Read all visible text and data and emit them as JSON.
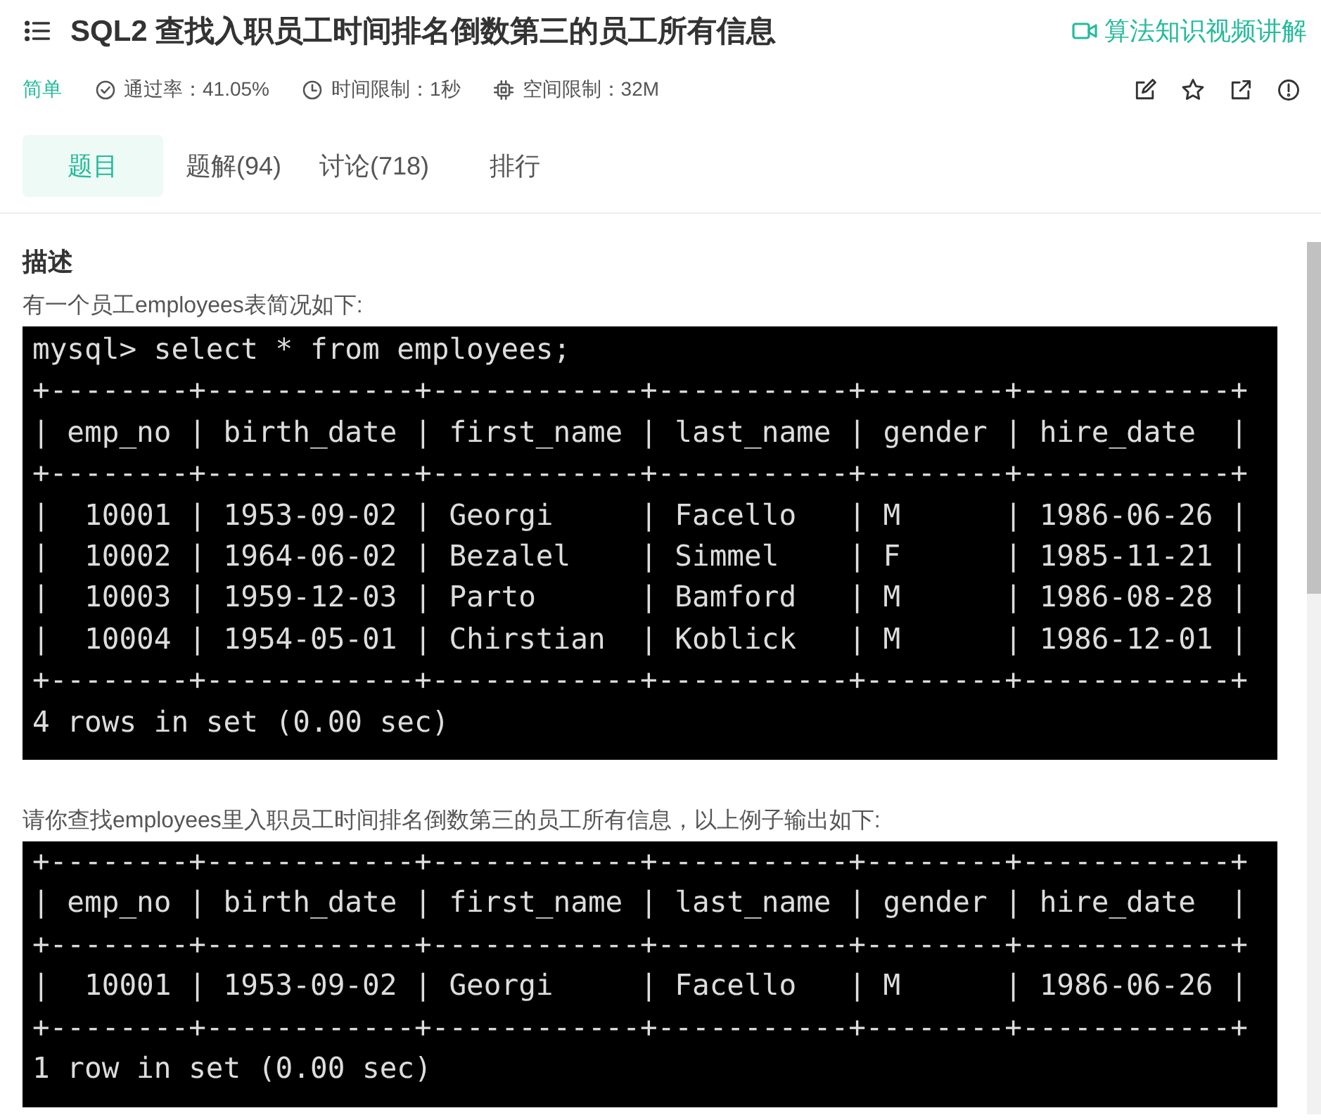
{
  "header": {
    "title": "SQL2  查找入职员工时间排名倒数第三的员工所有信息",
    "video_link": "算法知识视频讲解"
  },
  "meta": {
    "difficulty": "简单",
    "items": [
      {
        "kind": "pass",
        "text": "通过率：41.05%"
      },
      {
        "kind": "time",
        "text": "时间限制：1秒"
      },
      {
        "kind": "memory",
        "text": "空间限制：32M"
      }
    ]
  },
  "tabs": [
    {
      "label": "题目",
      "selected": true
    },
    {
      "label": "题解(94)",
      "selected": false
    },
    {
      "label": "讨论(718)",
      "selected": false
    },
    {
      "label": "排行",
      "selected": false
    }
  ],
  "content": {
    "heading": "描述",
    "blocks": [
      {
        "kind": "text",
        "text": "有一个员工employees表简况如下:"
      },
      {
        "kind": "terminal",
        "lines": [
          "mysql> select * from employees;",
          "+--------+------------+------------+-----------+--------+------------+",
          "| emp_no | birth_date | first_name | last_name | gender | hire_date  |",
          "+--------+------------+------------+-----------+--------+------------+",
          "|  10001 | 1953-09-02 | Georgi     | Facello   | M      | 1986-06-26 |",
          "|  10002 | 1964-06-02 | Bezalel    | Simmel    | F      | 1985-11-21 |",
          "|  10003 | 1959-12-03 | Parto      | Bamford   | M      | 1986-08-28 |",
          "|  10004 | 1954-05-01 | Chirstian  | Koblick   | M      | 1986-12-01 |",
          "+--------+------------+------------+-----------+--------+------------+",
          "4 rows in set (0.00 sec)"
        ]
      },
      {
        "kind": "text",
        "text": "请你查找employees里入职员工时间排名倒数第三的员工所有信息，以上例子输出如下:"
      },
      {
        "kind": "terminal",
        "lines": [
          "+--------+------------+------------+-----------+--------+------------+",
          "| emp_no | birth_date | first_name | last_name | gender | hire_date  |",
          "+--------+------------+------------+-----------+--------+------------+",
          "|  10001 | 1953-09-02 | Georgi     | Facello   | M      | 1986-06-26 |",
          "+--------+------------+------------+-----------+--------+------------+",
          "1 row in set (0.00 sec)"
        ]
      }
    ]
  }
}
